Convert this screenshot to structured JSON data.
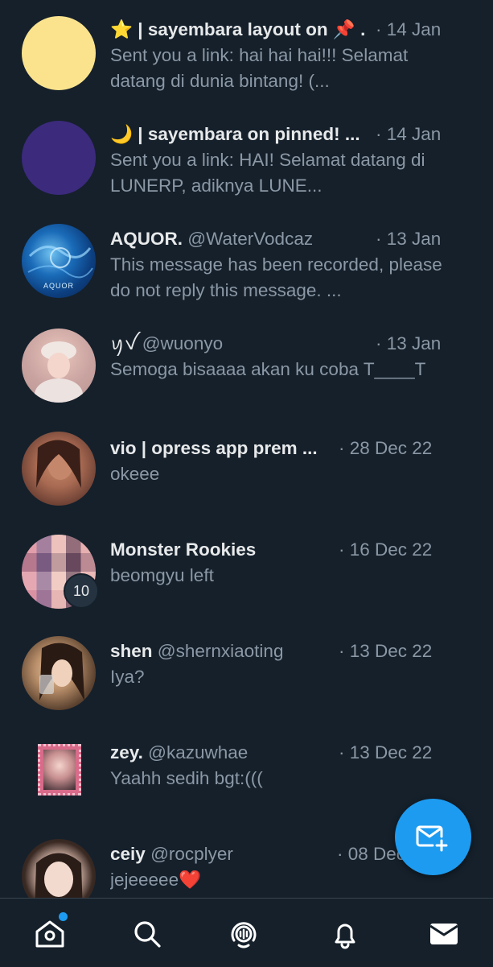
{
  "colors": {
    "background": "#15202b",
    "accent": "#1d9bf0",
    "secondary_text": "#8b98a5",
    "primary_text": "#e7e9ea"
  },
  "conversations": [
    {
      "name": "⭐ | sayembara layout on 📌 .",
      "handle": "",
      "date": "· 14 Jan",
      "message": "Sent you a link: hai hai hai!!! Selamat datang di dunia bintang! (...",
      "avatar": "yellow-circle"
    },
    {
      "name": "🌙 | sayembara on pinned! ...",
      "handle": "",
      "date": "· 14 Jan",
      "message": "Sent you a link: HAI! Selamat datang di LUNERP, adiknya LUNE...",
      "avatar": "purple-circle"
    },
    {
      "name": "AQUOR.",
      "handle": "@WaterVodcaz",
      "date": "· 13 Jan",
      "message": "This message has been recorded, please do not reply this message. ...",
      "avatar": "aquor-logo",
      "avatar_label": "AQUOR"
    },
    {
      "name": "ꪗꪜ",
      "handle": "@wuonyo",
      "date": "· 13 Jan",
      "message": "Semoga bisaaaa akan ku coba T____T",
      "avatar": "person-photo"
    },
    {
      "name": "vio | opress app prem ...",
      "handle": "",
      "date": "· 28 Dec 22",
      "message": "okeee",
      "avatar": "person-photo"
    },
    {
      "name": "Monster Rookies",
      "handle": "",
      "date": "· 16 Dec 22",
      "message": "beomgyu left",
      "avatar": "group-collage",
      "badge": "10"
    },
    {
      "name": "shen",
      "handle": "@shernxiaoting",
      "date": "· 13 Dec 22",
      "message": "Iya?",
      "avatar": "person-photo"
    },
    {
      "name": "zey.",
      "handle": "@kazuwhae",
      "date": "· 13 Dec 22",
      "message": "Yaahh sedih bgt:(((",
      "avatar": "stamp-photo"
    },
    {
      "name": "ceiy",
      "handle": "@rocplyer",
      "date": "· 08 Dec",
      "message": "jejeeeee❤️",
      "avatar": "person-photo"
    }
  ],
  "fab": {
    "icon": "new-message-icon"
  },
  "nav": [
    {
      "icon": "home-icon",
      "notification_dot": true
    },
    {
      "icon": "search-icon"
    },
    {
      "icon": "spaces-icon"
    },
    {
      "icon": "bell-icon"
    },
    {
      "icon": "mail-icon"
    }
  ]
}
